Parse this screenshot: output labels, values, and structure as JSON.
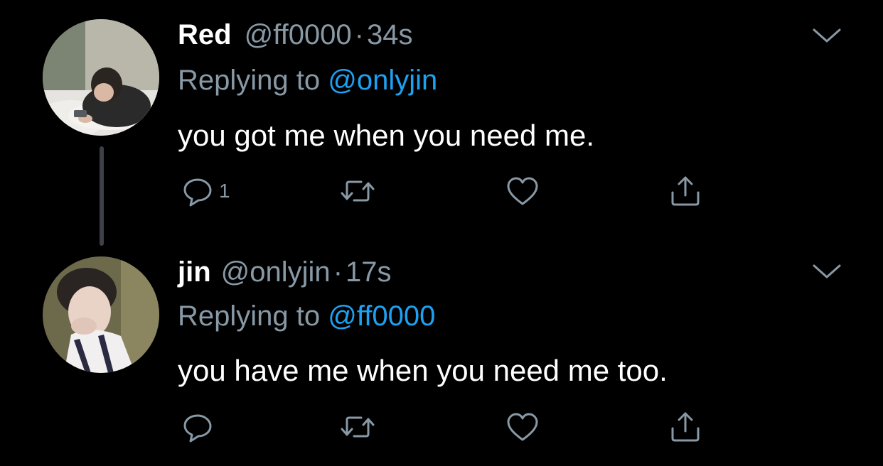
{
  "colors": {
    "background": "#000000",
    "primary_text": "#ffffff",
    "secondary_text": "#8899a6",
    "link": "#1da1f2",
    "thread_line": "#3d4147"
  },
  "tweets": [
    {
      "display_name": "Red",
      "handle": "@ff0000",
      "separator": "·",
      "time": "34s",
      "replying_prefix": "Replying to",
      "replying_to": "@onlyjin",
      "text": "you got me when you need me.",
      "reply_count": "1",
      "avatar_icon": "avatar-photo",
      "menu_icon": "chevron-down-icon",
      "actions": [
        "reply-icon",
        "retweet-icon",
        "like-icon",
        "share-icon"
      ]
    },
    {
      "display_name": "jin",
      "handle": "@onlyjin",
      "separator": "·",
      "time": "17s",
      "replying_prefix": "Replying to",
      "replying_to": "@ff0000",
      "text": "you have me when you need me too.",
      "reply_count": "",
      "avatar_icon": "avatar-photo",
      "menu_icon": "chevron-down-icon",
      "actions": [
        "reply-icon",
        "retweet-icon",
        "like-icon",
        "share-icon"
      ]
    }
  ]
}
